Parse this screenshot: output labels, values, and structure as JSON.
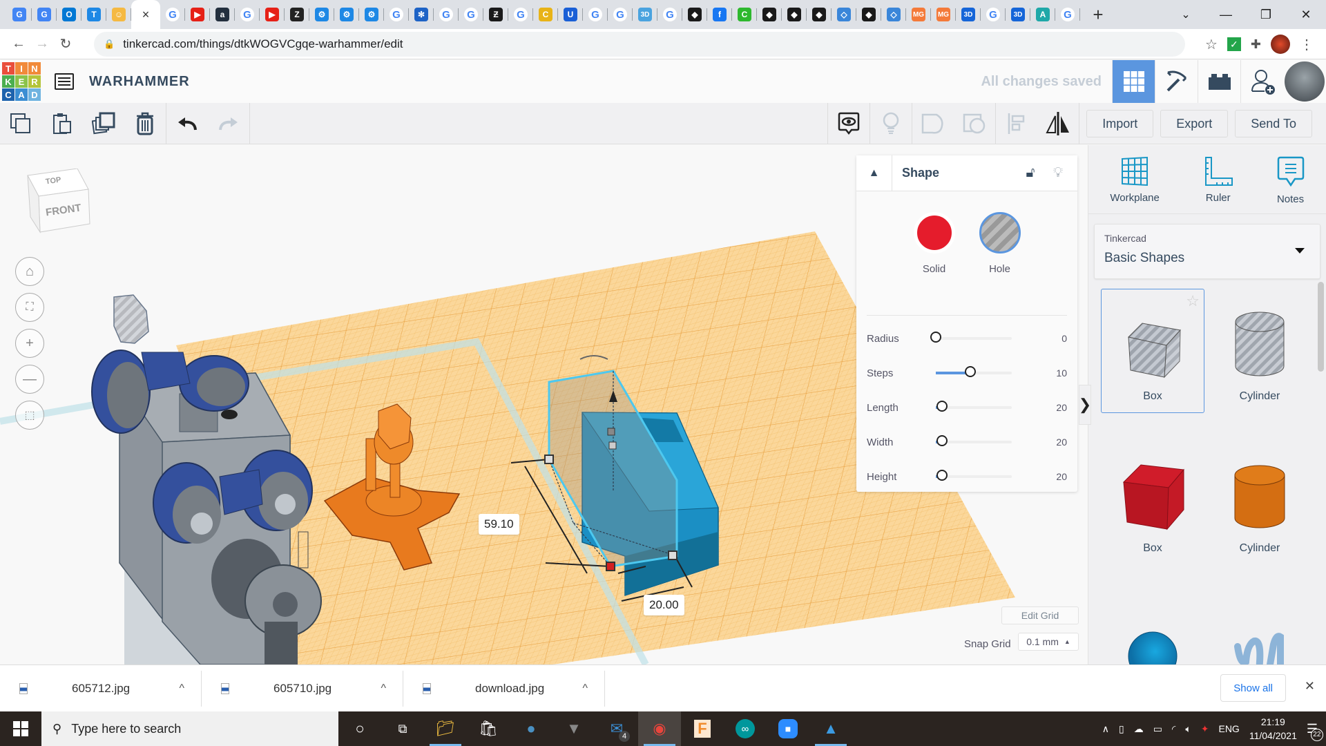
{
  "browser": {
    "tabs": [
      {
        "icon": "google-translate-icon",
        "glyph": "G",
        "color": "#4285f4"
      },
      {
        "icon": "google-translate-icon",
        "glyph": "G",
        "color": "#4285f4"
      },
      {
        "icon": "outlook-icon",
        "glyph": "O",
        "color": "#0078d4"
      },
      {
        "icon": "t-app-icon",
        "glyph": "T",
        "color": "#1e88e5"
      },
      {
        "icon": "character-icon",
        "glyph": "☺",
        "color": "#f5b942"
      },
      {
        "icon": "close-icon",
        "glyph": "×",
        "color": "#ffffff",
        "active": true
      },
      {
        "icon": "google-icon",
        "glyph": "G",
        "color": "g"
      },
      {
        "icon": "youtube-icon",
        "glyph": "▶",
        "color": "#e62117"
      },
      {
        "icon": "amazon-icon",
        "glyph": "a",
        "color": "#232f3e"
      },
      {
        "icon": "google-icon",
        "glyph": "G",
        "color": "g"
      },
      {
        "icon": "youtube-icon",
        "glyph": "▶",
        "color": "#e62117"
      },
      {
        "icon": "z-library-icon",
        "glyph": "Z",
        "color": "#222222"
      },
      {
        "icon": "gear-icon",
        "glyph": "⚙",
        "color": "#1e88e5"
      },
      {
        "icon": "gear-icon",
        "glyph": "⚙",
        "color": "#1e88e5"
      },
      {
        "icon": "gear-icon",
        "glyph": "⚙",
        "color": "#1e88e5"
      },
      {
        "icon": "google-icon",
        "glyph": "G",
        "color": "g"
      },
      {
        "icon": "snowflake-icon",
        "glyph": "✻",
        "color": "#1e63c6"
      },
      {
        "icon": "google-icon",
        "glyph": "G",
        "color": "g"
      },
      {
        "icon": "google-icon",
        "glyph": "G",
        "color": "g"
      },
      {
        "icon": "deviantart-icon",
        "glyph": "Ƶ",
        "color": "#1a1a1a"
      },
      {
        "icon": "google-icon",
        "glyph": "G",
        "color": "g"
      },
      {
        "icon": "c-comics-icon",
        "glyph": "C",
        "color": "#e8b317"
      },
      {
        "icon": "u-icon",
        "glyph": "U",
        "color": "#1a5fd6"
      },
      {
        "icon": "google-icon",
        "glyph": "G",
        "color": "g"
      },
      {
        "icon": "google-icon",
        "glyph": "G",
        "color": "g"
      },
      {
        "icon": "3d-icon",
        "glyph": "3D",
        "color": "#4aa3df"
      },
      {
        "icon": "google-icon",
        "glyph": "G",
        "color": "g"
      },
      {
        "icon": "diamond-icon",
        "glyph": "◆",
        "color": "#1a1a1a"
      },
      {
        "icon": "facebook-icon",
        "glyph": "f",
        "color": "#1877f2"
      },
      {
        "icon": "c-green-icon",
        "glyph": "C",
        "color": "#2eb82e"
      },
      {
        "icon": "diamond-icon",
        "glyph": "◆",
        "color": "#1a1a1a"
      },
      {
        "icon": "diamond-icon",
        "glyph": "◆",
        "color": "#1a1a1a"
      },
      {
        "icon": "diamond-icon",
        "glyph": "◆",
        "color": "#1a1a1a"
      },
      {
        "icon": "diamond-icon",
        "glyph": "◇",
        "color": "#3a86d9"
      },
      {
        "icon": "diamond-icon",
        "glyph": "◆",
        "color": "#1a1a1a"
      },
      {
        "icon": "diamond-icon",
        "glyph": "◇",
        "color": "#3a86d9"
      },
      {
        "icon": "mg-icon",
        "glyph": "MG",
        "color": "#f47a3a"
      },
      {
        "icon": "mg-icon",
        "glyph": "MG",
        "color": "#f47a3a"
      },
      {
        "icon": "3d-icon",
        "glyph": "3D",
        "color": "#1565d8"
      },
      {
        "icon": "google-icon",
        "glyph": "G",
        "color": "g"
      },
      {
        "icon": "3d-icon",
        "glyph": "3D",
        "color": "#1565d8"
      },
      {
        "icon": "autodesk-icon",
        "glyph": "A",
        "color": "#1fa8a8"
      },
      {
        "icon": "google-icon",
        "glyph": "G",
        "color": "g"
      }
    ],
    "new_tab": "+",
    "url": "tinkercad.com/things/dtkWOGVCgqe-warhammer/edit"
  },
  "header": {
    "logo_letters": [
      "T",
      "I",
      "N",
      "K",
      "E",
      "R",
      "C",
      "A",
      "D"
    ],
    "logo_colors": [
      "#e94e3c",
      "#f18a3a",
      "#f18a3a",
      "#4caf50",
      "#8bc34a",
      "#b4c43a",
      "#1e63ad",
      "#3b8ed3",
      "#6fb3e0"
    ],
    "project_title": "WARHAMMER",
    "save_status": "All changes saved"
  },
  "toolbar": {
    "import": "Import",
    "export": "Export",
    "send_to": "Send To"
  },
  "viewcube": {
    "top": "TOP",
    "front": "FRONT"
  },
  "viewport": {
    "dimension_length": "59.10",
    "dimension_width": "20.00"
  },
  "inspector": {
    "title": "Shape",
    "solid_label": "Solid",
    "hole_label": "Hole",
    "selected_mode": "Hole",
    "params": [
      {
        "label": "Radius",
        "value": "0",
        "fraction": 0.0
      },
      {
        "label": "Steps",
        "value": "10",
        "fraction": 0.45
      },
      {
        "label": "Length",
        "value": "20",
        "fraction": 0.08
      },
      {
        "label": "Width",
        "value": "20",
        "fraction": 0.08
      },
      {
        "label": "Height",
        "value": "20",
        "fraction": 0.08
      }
    ]
  },
  "right_panel": {
    "tools": [
      {
        "label": "Workplane",
        "icon": "workplane-icon"
      },
      {
        "label": "Ruler",
        "icon": "ruler-icon"
      },
      {
        "label": "Notes",
        "icon": "notes-icon"
      }
    ],
    "library_source": "Tinkercad",
    "library_name": "Basic Shapes",
    "shapes": [
      {
        "label": "Box",
        "kind": "box-hole",
        "selected": true
      },
      {
        "label": "Cylinder",
        "kind": "cylinder-hole"
      },
      {
        "label": "Box",
        "kind": "box-red"
      },
      {
        "label": "Cylinder",
        "kind": "cylinder-orange"
      },
      {
        "label": "Sphere",
        "kind": "sphere-blue"
      },
      {
        "label": "Scribble",
        "kind": "scribble"
      }
    ]
  },
  "grid": {
    "edit_grid": "Edit Grid",
    "snap_label": "Snap Grid",
    "snap_value": "0.1 mm"
  },
  "downloads": {
    "items": [
      "605712.jpg",
      "605710.jpg",
      "download.jpg"
    ],
    "show_all": "Show all"
  },
  "taskbar": {
    "search_placeholder": "Type here to search",
    "mail_badge": "4",
    "language": "ENG",
    "time": "21:19",
    "date": "11/04/2021",
    "notification_count": "22"
  }
}
